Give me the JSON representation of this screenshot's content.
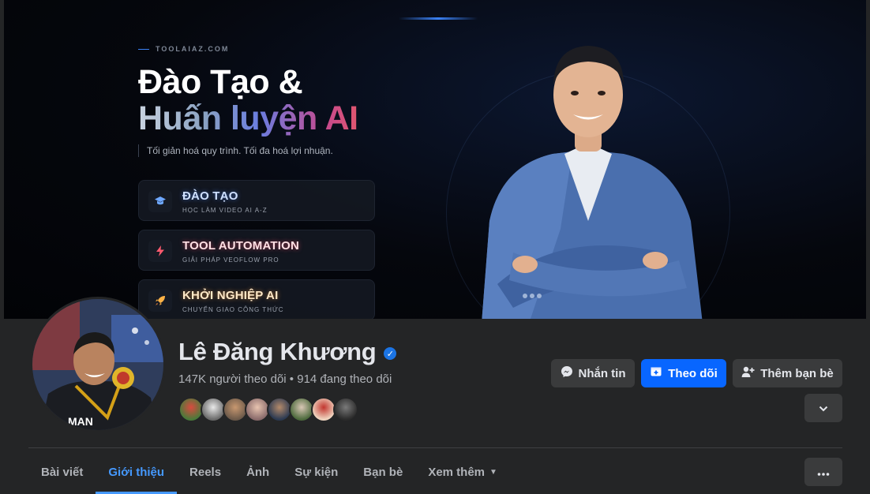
{
  "cover": {
    "site": "TOOLAIAZ.COM",
    "title_line1": "Đào Tạo &",
    "title_line2": "Huấn luyện AI",
    "tagline": "Tối giản hoá quy trình. Tối đa hoá lợi nhuận.",
    "services": [
      {
        "title": "ĐÀO TẠO",
        "subtitle": "HỌC LÀM VIDEO AI A-Z",
        "icon": "graduation-cap-icon"
      },
      {
        "title": "TOOL AUTOMATION",
        "subtitle": "GIẢI PHÁP VEOFLOW PRO",
        "icon": "lightning-icon"
      },
      {
        "title": "KHỞI NGHIỆP AI",
        "subtitle": "CHUYỂN GIAO CÔNG THỨC",
        "icon": "rocket-icon"
      }
    ]
  },
  "profile": {
    "name": "Lê Đăng Khương",
    "verified": true,
    "stats": "147K người theo dõi • 914 đang theo dõi"
  },
  "actions": {
    "message": "Nhắn tin",
    "follow": "Theo dõi",
    "add_friend": "Thêm bạn bè"
  },
  "tabs": [
    {
      "label": "Bài viết",
      "active": false
    },
    {
      "label": "Giới thiệu",
      "active": true
    },
    {
      "label": "Reels",
      "active": false
    },
    {
      "label": "Ảnh",
      "active": false
    },
    {
      "label": "Sự kiện",
      "active": false
    },
    {
      "label": "Bạn bè",
      "active": false
    },
    {
      "label": "Xem thêm",
      "active": false
    }
  ],
  "colors": {
    "accent": "#0866ff",
    "active_tab": "#4599ff",
    "background": "#242526",
    "button": "#3a3b3c"
  }
}
